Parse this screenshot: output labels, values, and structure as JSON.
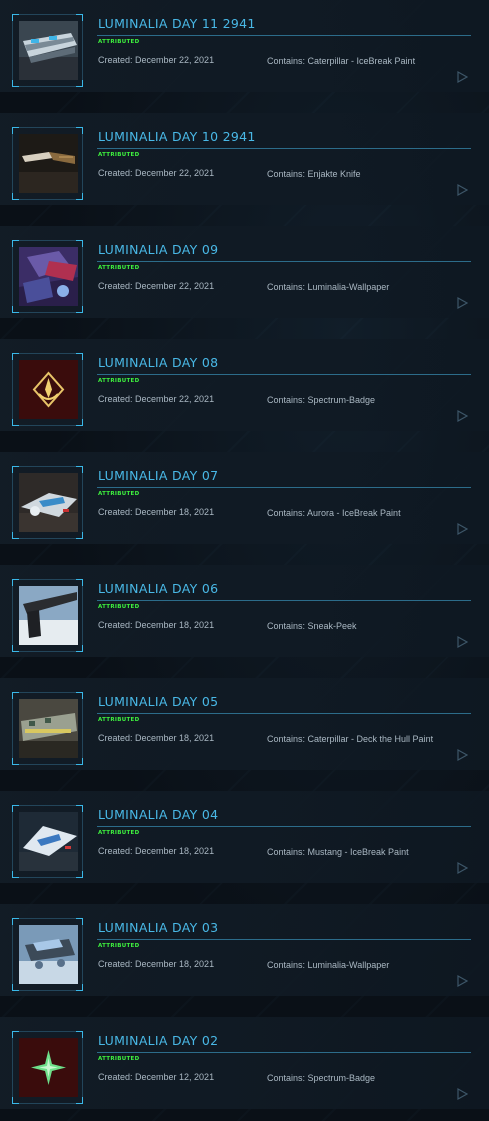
{
  "colors": {
    "title": "#49b8e6",
    "status": "#3ef23e",
    "text": "#aab8c3",
    "accent": "#3ab8e8"
  },
  "items": [
    {
      "title": "LUMINALIA DAY 11 2941",
      "status": "ATTRIBUTED",
      "created": "Created: December 22, 2021",
      "contains": "Contains: Caterpillar - IceBreak Paint",
      "thumb": "ship-ice"
    },
    {
      "title": "LUMINALIA DAY 10 2941",
      "status": "ATTRIBUTED",
      "created": "Created: December 22, 2021",
      "contains": "Contains: Enjakte Knife",
      "thumb": "knife"
    },
    {
      "title": "LUMINALIA DAY 09",
      "status": "ATTRIBUTED",
      "created": "Created: December 22, 2021",
      "contains": "Contains: Luminalia-Wallpaper",
      "thumb": "wallpaper-purple"
    },
    {
      "title": "LUMINALIA DAY 08",
      "status": "ATTRIBUTED",
      "created": "Created: December 22, 2021",
      "contains": "Contains: Spectrum-Badge",
      "thumb": "badge-gold"
    },
    {
      "title": "LUMINALIA DAY 07",
      "status": "ATTRIBUTED",
      "created": "Created: December 18, 2021",
      "contains": "Contains: Aurora - IceBreak Paint",
      "thumb": "ship-aurora"
    },
    {
      "title": "LUMINALIA DAY 06",
      "status": "ATTRIBUTED",
      "created": "Created: December 18, 2021",
      "contains": "Contains: Sneak-Peek",
      "thumb": "sneak-peek"
    },
    {
      "title": "LUMINALIA DAY 05",
      "status": "ATTRIBUTED",
      "created": "Created: December 18, 2021",
      "contains": "Contains: Caterpillar - Deck the Hull Paint",
      "thumb": "ship-hull"
    },
    {
      "title": "LUMINALIA DAY 04",
      "status": "ATTRIBUTED",
      "created": "Created: December 18, 2021",
      "contains": "Contains: Mustang - IceBreak Paint",
      "thumb": "ship-mustang"
    },
    {
      "title": "LUMINALIA DAY 03",
      "status": "ATTRIBUTED",
      "created": "Created: December 18, 2021",
      "contains": "Contains: Luminalia-Wallpaper",
      "thumb": "wallpaper-snow"
    },
    {
      "title": "LUMINALIA DAY 02",
      "status": "ATTRIBUTED",
      "created": "Created: December 12, 2021",
      "contains": "Contains: Spectrum-Badge",
      "thumb": "badge-green"
    }
  ]
}
